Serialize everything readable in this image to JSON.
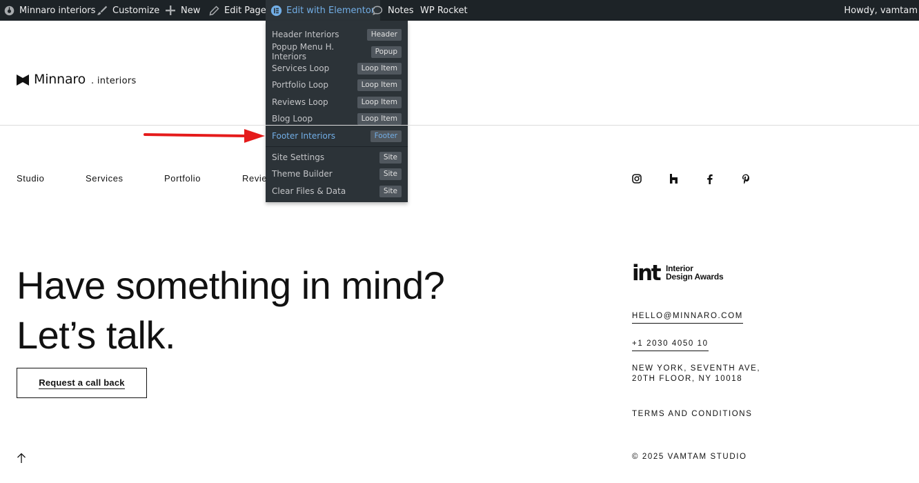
{
  "adminbar": {
    "site_name": "Minnaro interiors",
    "customize": "Customize",
    "new": "New",
    "edit_page": "Edit Page",
    "edit_elementor": "Edit with Elementor",
    "notes": "Notes",
    "wp_rocket": "WP Rocket",
    "howdy": "Howdy, vamtam"
  },
  "elementor_menu": {
    "items": [
      {
        "label": "Header Interiors",
        "badge": "Header"
      },
      {
        "label": "Popup Menu H. Interiors",
        "badge": "Popup"
      },
      {
        "label": "Services Loop",
        "badge": "Loop Item"
      },
      {
        "label": "Portfolio Loop",
        "badge": "Loop Item"
      },
      {
        "label": "Reviews Loop",
        "badge": "Loop Item"
      },
      {
        "label": "Blog Loop",
        "badge": "Loop Item"
      },
      {
        "label": "Footer Interiors",
        "badge": "Footer"
      },
      {
        "label": "Site Settings",
        "badge": "Site"
      },
      {
        "label": "Theme Builder",
        "badge": "Site"
      },
      {
        "label": "Clear Files & Data",
        "badge": "Site"
      }
    ]
  },
  "logo": {
    "name": "Minnaro",
    "sub": ". interiors"
  },
  "nav": {
    "items": [
      "Studio",
      "Services",
      "Portfolio",
      "Revie"
    ]
  },
  "social_icons": [
    "instagram-icon",
    "houzz-icon",
    "facebook-icon",
    "pinterest-icon"
  ],
  "hero": {
    "line1": "Have something in mind?",
    "line2": "Let’s talk.",
    "cta": "Request a call back"
  },
  "award": {
    "logo_text": "int",
    "line1": "Interior",
    "line2": "Design Awards"
  },
  "contact": {
    "email": "HELLO@MINNARO.COM",
    "phone": "+1 2030 4050 10",
    "address_line1": "NEW YORK, SEVENTH AVE,",
    "address_line2": "20TH FLOOR, NY 10018",
    "terms": "TERMS AND CONDITIONS",
    "copyright": "© 2025 VAMTAM STUDIO"
  },
  "colors": {
    "adminbar_bg": "#1d2327",
    "dropdown_bg": "#2c3338",
    "highlight": "#72aee6",
    "annotation_arrow": "#e51b1b"
  }
}
